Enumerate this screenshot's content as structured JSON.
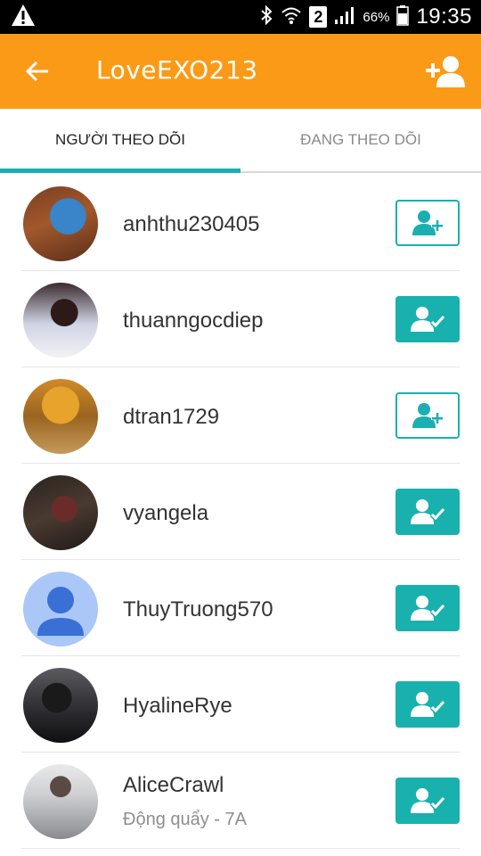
{
  "status_bar": {
    "sim_slot": "2",
    "battery": "66%",
    "time": "19:35",
    "icons": [
      "warning-icon",
      "bluetooth-icon",
      "wifi-icon",
      "signal-icon",
      "battery-icon"
    ]
  },
  "toolbar": {
    "title": "LoveEXO213",
    "background": "#fb9a16"
  },
  "tabs": [
    {
      "label": "NGƯỜI THEO DÕI",
      "active": true
    },
    {
      "label": "ĐANG THEO DÕI",
      "active": false
    }
  ],
  "accent": "#1aafb0",
  "users": [
    {
      "name": "anhthu230405",
      "subtitle": "",
      "following": false
    },
    {
      "name": "thuanngocdiep",
      "subtitle": "",
      "following": true
    },
    {
      "name": "dtran1729",
      "subtitle": "",
      "following": false
    },
    {
      "name": "vyangela",
      "subtitle": "",
      "following": true
    },
    {
      "name": "ThuyTruong570",
      "subtitle": "",
      "following": true
    },
    {
      "name": "HyalineRye",
      "subtitle": "",
      "following": true
    },
    {
      "name": "AliceCrawl",
      "subtitle": "Động quẩy - 7A",
      "following": true
    }
  ]
}
